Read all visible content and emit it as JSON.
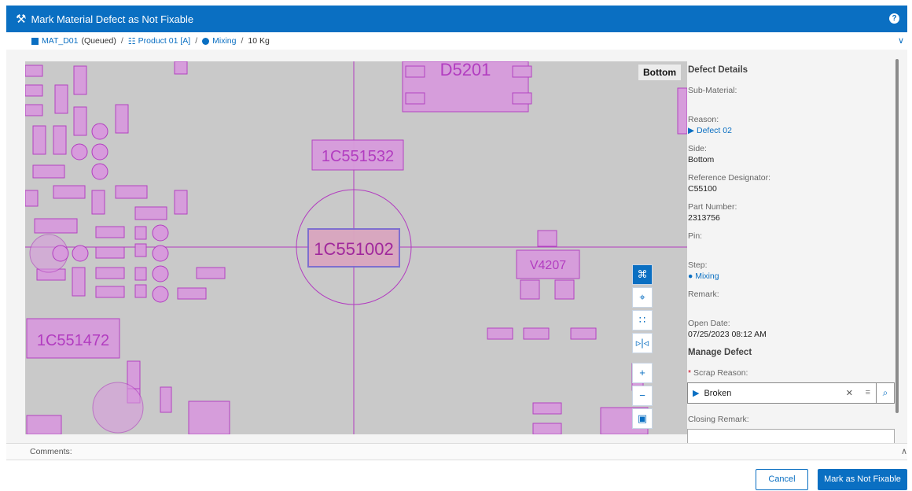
{
  "titlebar": {
    "title": "Mark Material Defect as Not Fixable",
    "icon": "tools-icon",
    "help_icon": "?"
  },
  "breadcrumb": {
    "material": "MAT_D01",
    "material_status": "(Queued)",
    "product": "Product 01 [A]",
    "step": "Mixing",
    "quantity": "10 Kg",
    "separator": "/"
  },
  "canvas": {
    "side_label": "Bottom",
    "components": [
      {
        "label": "C55100",
        "display": "1C551002"
      },
      {
        "label": "C55153",
        "display": "1C551532"
      },
      {
        "label": "C55147",
        "display": "1C551472"
      },
      {
        "label": "V4207",
        "display": "V4207"
      },
      {
        "label": "D5201",
        "display": "D5201"
      }
    ]
  },
  "details": {
    "header": "Defect Details",
    "sub_material_label": "Sub-Material:",
    "reason_label": "Reason:",
    "reason_value": "Defect 02",
    "side_label": "Side:",
    "side_value": "Bottom",
    "refdes_label": "Reference Designator:",
    "refdes_value": "C55100",
    "part_number_label": "Part Number:",
    "part_number_value": "2313756",
    "pin_label": "Pin:",
    "step_label": "Step:",
    "step_value": "Mixing",
    "remark_label": "Remark:",
    "open_date_label": "Open Date:",
    "open_date_value": "07/25/2023 08:12 AM",
    "manage_header": "Manage Defect",
    "scrap_reason_label": "Scrap Reason:",
    "scrap_reason_required": "*",
    "scrap_reason_value": "Broken",
    "closing_remark_label": "Closing Remark:"
  },
  "comments": {
    "label": "Comments:"
  },
  "footer": {
    "cancel_label": "Cancel",
    "mark_label": "Mark as Not Fixable"
  },
  "colors": {
    "accent": "#0a6fc2",
    "pcb_background": "#c9c9c9",
    "pad_fill": "#d79bdc",
    "pad_stroke": "#b23cc0"
  }
}
